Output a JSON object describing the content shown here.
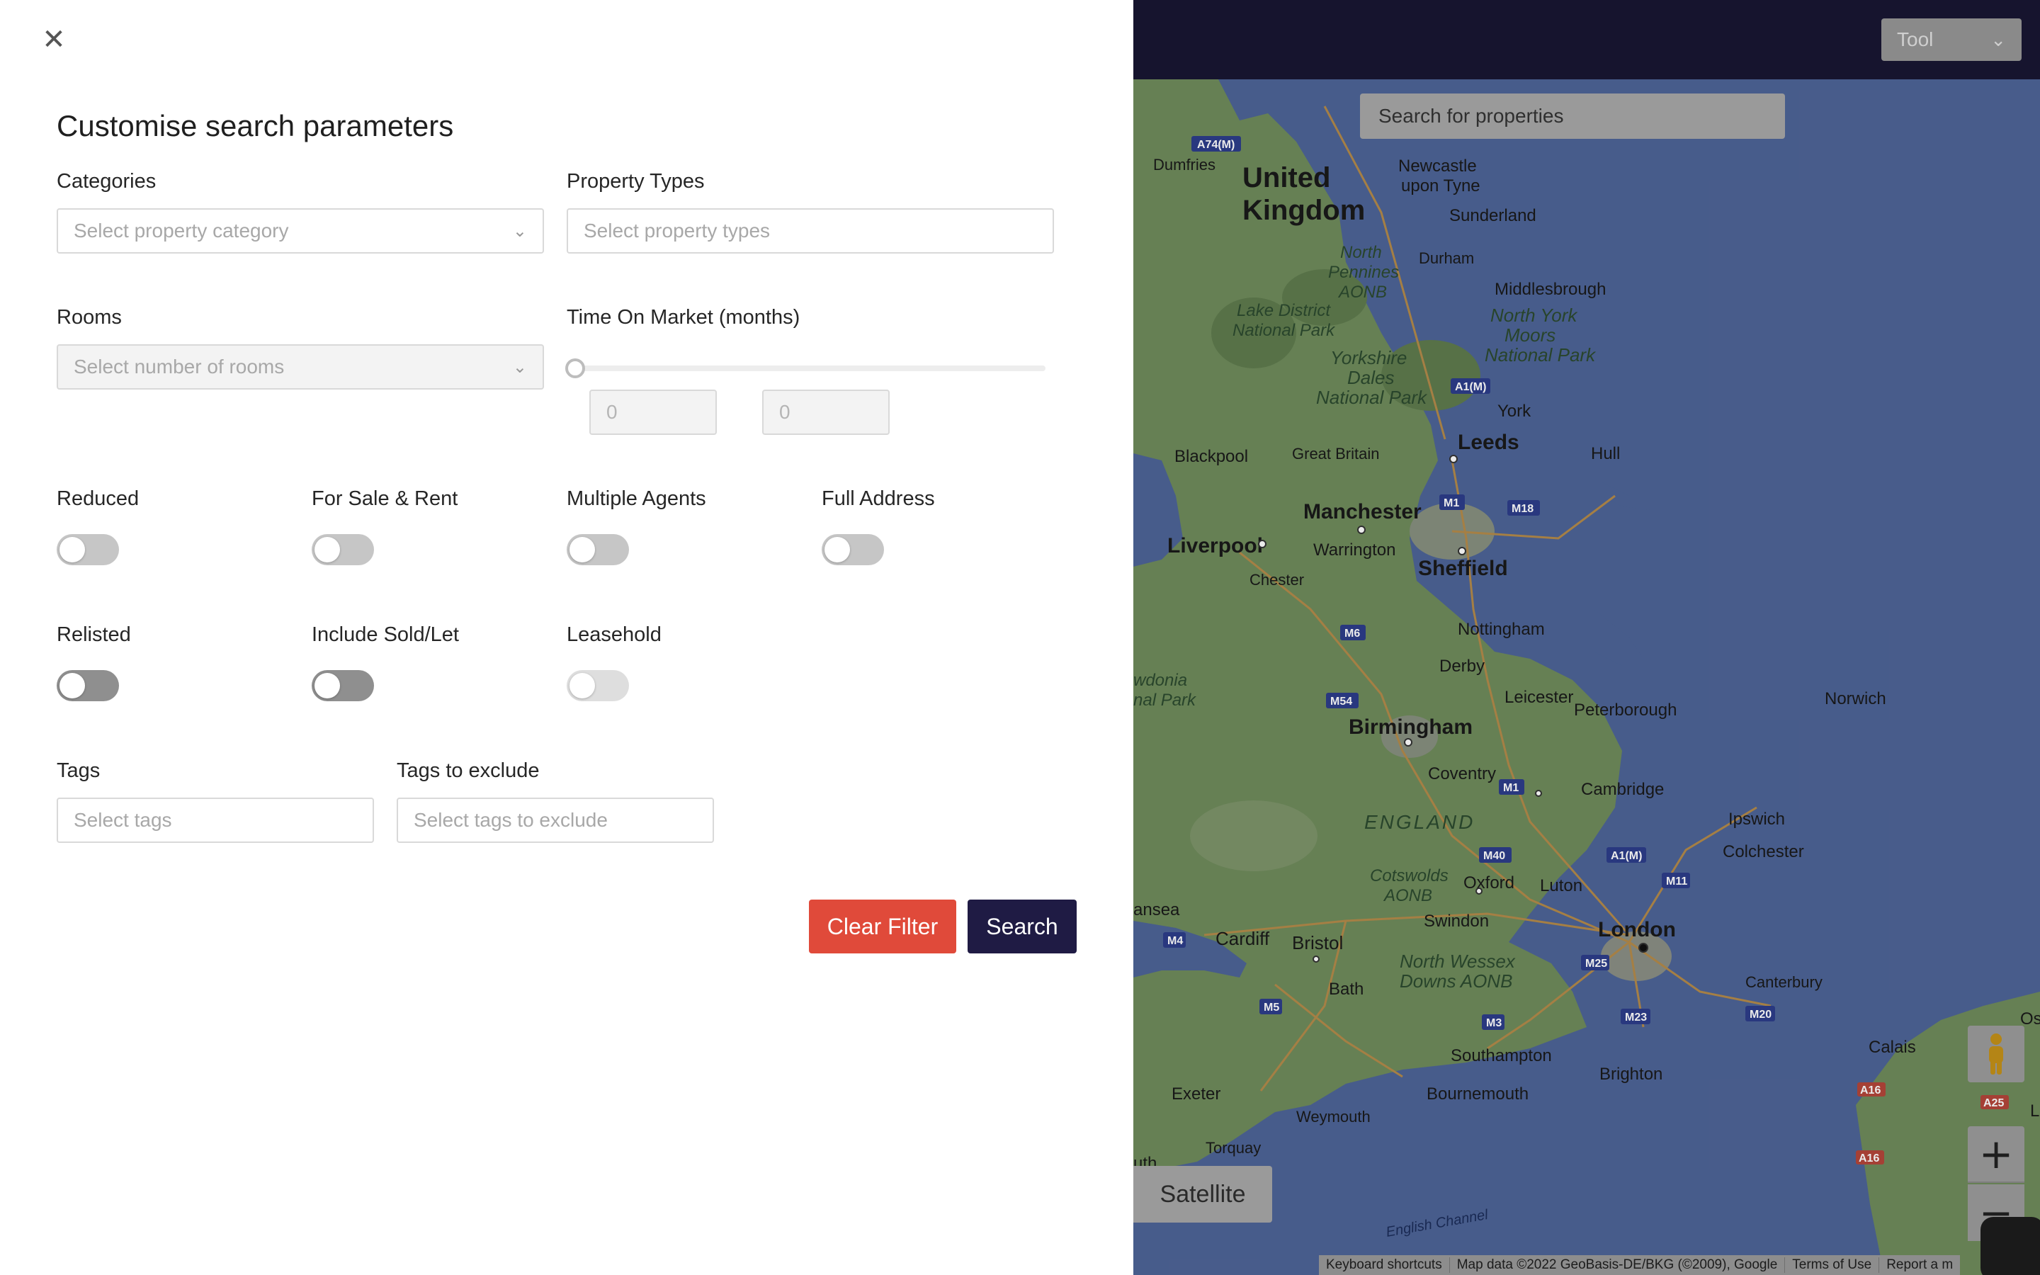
{
  "panel": {
    "close_icon": "close-icon",
    "title": "Customise search parameters",
    "categories": {
      "label": "Categories",
      "placeholder": "Select property category"
    },
    "property_types": {
      "label": "Property Types",
      "placeholder": "Select property types"
    },
    "rooms": {
      "label": "Rooms",
      "placeholder": "Select number of rooms"
    },
    "time_on_market": {
      "label": "Time On Market (months)",
      "min_value": "0",
      "max_value": "0",
      "slider_value": 0
    },
    "toggles": {
      "reduced": {
        "label": "Reduced",
        "on": false
      },
      "for_sale_rent": {
        "label": "For Sale & Rent",
        "on": false
      },
      "multiple_agents": {
        "label": "Multiple Agents",
        "on": false
      },
      "full_address": {
        "label": "Full Address",
        "on": false
      },
      "relisted": {
        "label": "Relisted",
        "on": false
      },
      "include_sold_let": {
        "label": "Include Sold/Let",
        "on": false
      },
      "leasehold": {
        "label": "Leasehold",
        "on": false
      }
    },
    "tags": {
      "label": "Tags",
      "placeholder": "Select tags"
    },
    "tags_exclude": {
      "label": "Tags to exclude",
      "placeholder": "Select tags to exclude"
    },
    "clear_button": "Clear Filter",
    "search_button": "Search",
    "colors": {
      "clear": "#e04a3a",
      "search": "#1f1b44"
    }
  },
  "map": {
    "tool_select": "Tool",
    "search_placeholder": "Search for properties",
    "satellite_button": "Satellite",
    "zoom_in": "+",
    "zoom_out": "−",
    "attribution": [
      "Keyboard shortcuts",
      "Map data ©2022 GeoBasis-DE/BKG (©2009), Google",
      "Terms of Use",
      "Report a m"
    ],
    "places": {
      "united_kingdom": [
        "United",
        "Kingdom"
      ],
      "newcastle": [
        "Newcastle",
        "upon Tyne"
      ],
      "sunderland": "Sunderland",
      "dumfries": "Dumfries",
      "durham": "Durham",
      "middlesbrough": "Middlesbrough",
      "north_pennines": [
        "North",
        "Pennines",
        "AONB"
      ],
      "lake_district": [
        "Lake District",
        "National Park"
      ],
      "north_york_moors": [
        "North York",
        "Moors",
        "National Park"
      ],
      "yorkshire_dales": [
        "Yorkshire",
        "Dales",
        "National Park"
      ],
      "york": "York",
      "leeds": "Leeds",
      "hull": "Hull",
      "blackpool": "Blackpool",
      "great_britain": "Great Britain",
      "manchester": "Manchester",
      "liverpool": "Liverpool",
      "warrington": "Warrington",
      "sheffield": "Sheffield",
      "chester": "Chester",
      "nottingham": "Nottingham",
      "derby": "Derby",
      "leicester": "Leicester",
      "peterborough": "Peterborough",
      "norwich": "Norwich",
      "wdonia": [
        "wdonia",
        "nal Park"
      ],
      "birmingham": "Birmingham",
      "coventry": "Coventry",
      "cambridge": "Cambridge",
      "england": "ENGLAND",
      "ipswich": "Ipswich",
      "colchester": "Colchester",
      "cotswolds": [
        "Cotswolds",
        "AONB"
      ],
      "oxford": "Oxford",
      "luton": "Luton",
      "ansea": "ansea",
      "cardiff": "Cardiff",
      "bristol": "Bristol",
      "swindon": "Swindon",
      "london": "London",
      "north_wessex": [
        "North Wessex",
        "Downs AONB"
      ],
      "bath": "Bath",
      "canterbury": "Canterbury",
      "southampton": "Southampton",
      "calais": "Calais",
      "brighton": "Brighton",
      "bournemouth": "Bournemouth",
      "exeter": "Exeter",
      "weymouth": "Weymouth",
      "torquay": "Torquay",
      "uth": "uth",
      "english_channel": "English Channel",
      "oste": "Oste",
      "l": "L"
    },
    "roads": [
      "A74(M)",
      "A1(M)",
      "M1",
      "M18",
      "M6",
      "M54",
      "M1",
      "M40",
      "A1(M)",
      "M11",
      "M4",
      "M5",
      "M25",
      "M3",
      "M23",
      "M20",
      "A16",
      "A25",
      "A16"
    ]
  }
}
